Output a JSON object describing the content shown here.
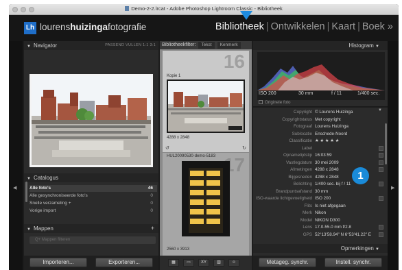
{
  "window": {
    "title": "Demo-2-2.lrcat - Adobe Photoshop Lightroom Classic - Bibliotheek"
  },
  "identity": {
    "logo": "Lh",
    "brand_light": "lourens",
    "brand_bold": "huizinga",
    "brand_rest": "fotografie"
  },
  "modules": {
    "items": [
      "Bibliotheek",
      "Ontwikkelen",
      "Kaart",
      "Boek »"
    ],
    "active": "Bibliotheek"
  },
  "navigator": {
    "title": "Navigator",
    "options": "PASSEND   VULLEN   1:1   3:1"
  },
  "catalogus": {
    "title": "Catalogus",
    "rows": [
      {
        "label": "Alle foto's",
        "count": "46"
      },
      {
        "label": "Alle gesynchroniseerde foto's",
        "count": "0"
      },
      {
        "label": "Snelle verzameling +",
        "count": "0"
      },
      {
        "label": "Vorige import",
        "count": "0"
      }
    ]
  },
  "mappen": {
    "title": "Mappen",
    "add": "+",
    "search_placeholder": "Q+ Mappen filteren"
  },
  "left_buttons": {
    "import": "Importeren...",
    "export": "Exporteren..."
  },
  "grid": {
    "filter_label": "Bibliotheekfilter:",
    "filters": [
      "Tekst",
      "Kenmerk"
    ],
    "cell1": {
      "index": "16",
      "label": "Kopie 1",
      "dims": "4288 x 2848"
    },
    "cell2": {
      "index": "17",
      "filename": "HUL20090530-demo-5183",
      "dims": "2560 x 3913"
    }
  },
  "histogram": {
    "title": "Histogram",
    "iso": "ISO 200",
    "focal": "30 mm",
    "aperture": "f / 11",
    "shutter": "1/400 sec.",
    "original": "Originele foto"
  },
  "metadata": {
    "rows": [
      {
        "k": "Copyright",
        "v": "© Lourens Huizinga"
      },
      {
        "k": "Copyrightstatus",
        "v": "Met copyright"
      },
      {
        "k": "Fotograaf",
        "v": "Lourens Huizinga"
      },
      {
        "k": "Sublocatie",
        "v": "Enschede-Noord"
      },
      {
        "k": "Classificatie",
        "v": "★ ★ ★ ★ ★"
      },
      {
        "k": "Label",
        "v": ""
      },
      {
        "k": "Opnametijdstip",
        "v": "16:03:59"
      },
      {
        "k": "Vastlegdatum",
        "v": "30 mei 2009"
      },
      {
        "k": "Afmetingen",
        "v": "4288 x 2848"
      },
      {
        "k": "Bijgesneden",
        "v": "4288 x 2848"
      },
      {
        "k": "Belichting",
        "v": "1/400 sec. bij f / 11"
      },
      {
        "k": "Brandpuntsafstand",
        "v": "30 mm"
      },
      {
        "k": "ISO-waarde lichtgevoeligheid",
        "v": "ISO 200"
      },
      {
        "k": "Flits",
        "v": "Is niet afgegaan"
      },
      {
        "k": "Merk",
        "v": "Nikon"
      },
      {
        "k": "Model",
        "v": "NIKON D300"
      },
      {
        "k": "Lens",
        "v": "17.0-55.0 mm f/2.8"
      },
      {
        "k": "GPS",
        "v": "52°13'58.94\" N 6°53'41.22\" E"
      }
    ],
    "opmerkingen": "Opmerkingen"
  },
  "right_buttons": {
    "sync_meta": "Metageg. synchr.",
    "sync_settings": "Instell. synchr."
  },
  "badge": "1",
  "colors": {
    "accent": "#1a8bd9",
    "panel": "#2b2b2b",
    "logo": "#1f6ec8"
  }
}
